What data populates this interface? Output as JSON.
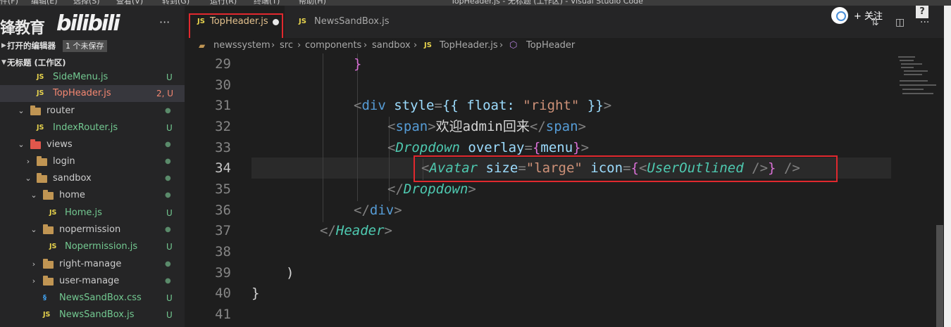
{
  "titlebar": {
    "menus": [
      "件(F)",
      "编辑(E)",
      "选择(S)",
      "查看(V)",
      "转到(G)",
      "运行(R)",
      "终端(T)",
      "帮助(H)"
    ],
    "title": "TopHeader.js - 无标题 (工作区) - Visual Studio Code"
  },
  "sidebar": {
    "logo_text": "锋教育",
    "watermark": "bilibili",
    "more": "···",
    "open_editors": {
      "label": "打开的编辑器",
      "badge": "1 个未保存"
    },
    "workspace": {
      "label": "无标题 (工作区)"
    },
    "tree": [
      {
        "name": "SideMenu.js",
        "status": "U",
        "type": "js"
      },
      {
        "name": "TopHeader.js",
        "status": "2, U",
        "type": "js"
      },
      {
        "name": "router",
        "status": "●",
        "type": "folder"
      },
      {
        "name": "IndexRouter.js",
        "status": "U",
        "type": "js"
      },
      {
        "name": "views",
        "status": "●",
        "type": "folder"
      },
      {
        "name": "login",
        "status": "●",
        "type": "folder"
      },
      {
        "name": "sandbox",
        "status": "●",
        "type": "folder"
      },
      {
        "name": "home",
        "status": "●",
        "type": "folder"
      },
      {
        "name": "Home.js",
        "status": "U",
        "type": "js"
      },
      {
        "name": "nopermission",
        "status": "●",
        "type": "folder"
      },
      {
        "name": "Nopermission.js",
        "status": "U",
        "type": "js"
      },
      {
        "name": "right-manage",
        "status": "●",
        "type": "folder"
      },
      {
        "name": "user-manage",
        "status": "●",
        "type": "folder"
      },
      {
        "name": "NewsSandBox.css",
        "status": "U",
        "type": "css"
      },
      {
        "name": "NewsSandBox.js",
        "status": "U",
        "type": "js"
      }
    ]
  },
  "tabs": [
    {
      "label": "TopHeader.js",
      "active": true,
      "dirty": true,
      "icon": "JS"
    },
    {
      "label": "NewsSandBox.js",
      "active": false,
      "dirty": false,
      "icon": "JS"
    }
  ],
  "overlay": {
    "follow_label": "+ 关注",
    "help": "?"
  },
  "breadcrumb": [
    "newssystem",
    "src",
    "components",
    "sandbox",
    "TopHeader.js",
    "TopHeader"
  ],
  "editor": {
    "line_numbers": [
      "29",
      "30",
      "31",
      "32",
      "33",
      "34",
      "35",
      "36",
      "37",
      "38",
      "39",
      "40",
      "41"
    ],
    "current_line": "34",
    "code": {
      "l29": "}",
      "l31_tag": "div",
      "l31_attr": "style",
      "l31_obj": "{{ float: ",
      "l31_str": "\"right\"",
      "l31_end": " }}",
      "l32_tag": "span",
      "l32_text": "欢迎admin回来",
      "l33_tag": "Dropdown",
      "l33_attr": "overlay",
      "l33_val": "menu",
      "l34_tag": "Avatar",
      "l34_attr1": "size",
      "l34_str": "\"large\"",
      "l34_attr2": "icon",
      "l34_comp": "UserOutlined",
      "l35_tag": "Dropdown",
      "l36_tag": "div",
      "l37_tag": "Header",
      "l39": ")",
      "l40": "}"
    }
  },
  "colors": {
    "accent_highlight": "#e0282e",
    "tab_modified": "#e2c08d",
    "git_untracked": "#73c991"
  }
}
